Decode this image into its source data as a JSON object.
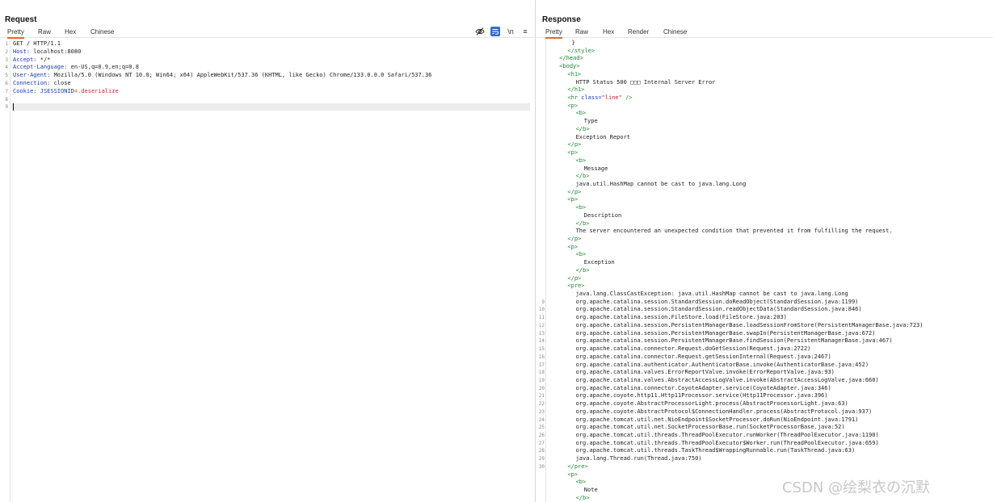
{
  "request": {
    "title": "Request",
    "tabs": [
      "Pretty",
      "Raw",
      "Hex",
      "Chinese"
    ],
    "active_tab": "Pretty",
    "tools": [
      "eye-off-icon",
      "wrap-icon",
      "\\n",
      "≡"
    ],
    "lines": [
      {
        "n": "1",
        "text": "GET / HTTP/1.1"
      },
      {
        "n": "2",
        "name": "Host",
        "value": " localhost:8080"
      },
      {
        "n": "3",
        "name": "Accept",
        "value": " */*"
      },
      {
        "n": "4",
        "name": "Accept-Language",
        "value": " en-US,q=0.9,en;q=0.8"
      },
      {
        "n": "5",
        "name": "User-Agent",
        "value": " Mozilla/5.0 (Windows NT 10.0; Win64; x64) AppleWebKit/537.36 (KHTML, like Gecko) Chrome/133.0.0.0 Safari/537.36"
      },
      {
        "n": "6",
        "name": "Connection",
        "value": " close"
      },
      {
        "n": "7",
        "name": "Cookie",
        "cookie_name": " JSESSIONID",
        "cookie_value": "=.deserialize"
      },
      {
        "n": "8",
        "text": ""
      },
      {
        "n": "9",
        "text": ""
      }
    ]
  },
  "response": {
    "title": "Response",
    "tabs": [
      "Pretty",
      "Raw",
      "Hex",
      "Render",
      "Chinese"
    ],
    "active_tab": "Pretty",
    "lines": [
      {
        "n": "",
        "indent": 10,
        "html": "}"
      },
      {
        "n": "",
        "indent": 8,
        "html": "<span class='tag'>&lt;/style&gt;</span>"
      },
      {
        "n": "",
        "indent": 4,
        "html": "<span class='tag'>&lt;/head&gt;</span>"
      },
      {
        "n": "",
        "indent": 4,
        "html": "<span class='tag'>&lt;body&gt;</span>"
      },
      {
        "n": "",
        "indent": 8,
        "html": "<span class='tag'>&lt;h1&gt;</span>"
      },
      {
        "n": "",
        "indent": 12,
        "html": "HTTP Status 500 □□□ Internal Server Error"
      },
      {
        "n": "",
        "indent": 8,
        "html": "<span class='tag'>&lt;/h1&gt;</span>"
      },
      {
        "n": "",
        "indent": 8,
        "html": "<span class='tag'>&lt;hr </span><span class='attr-name'>class=</span><span class='attr-val'>\"line\"</span><span class='tag'> /&gt;</span>"
      },
      {
        "n": "",
        "indent": 8,
        "html": "<span class='tag'>&lt;p&gt;</span>"
      },
      {
        "n": "",
        "indent": 12,
        "html": "<span class='tag'>&lt;b&gt;</span>"
      },
      {
        "n": "",
        "indent": 16,
        "html": "Type"
      },
      {
        "n": "",
        "indent": 12,
        "html": "<span class='tag'>&lt;/b&gt;</span>"
      },
      {
        "n": "",
        "indent": 12,
        "html": "Exception Report"
      },
      {
        "n": "",
        "indent": 8,
        "html": "<span class='tag'>&lt;/p&gt;</span>"
      },
      {
        "n": "",
        "indent": 8,
        "html": "<span class='tag'>&lt;p&gt;</span>"
      },
      {
        "n": "",
        "indent": 12,
        "html": "<span class='tag'>&lt;b&gt;</span>"
      },
      {
        "n": "",
        "indent": 16,
        "html": "Message"
      },
      {
        "n": "",
        "indent": 12,
        "html": "<span class='tag'>&lt;/b&gt;</span>"
      },
      {
        "n": "",
        "indent": 12,
        "html": "java.util.HashMap cannot be cast to java.lang.Long"
      },
      {
        "n": "",
        "indent": 8,
        "html": "<span class='tag'>&lt;/p&gt;</span>"
      },
      {
        "n": "",
        "indent": 8,
        "html": "<span class='tag'>&lt;p&gt;</span>"
      },
      {
        "n": "",
        "indent": 12,
        "html": "<span class='tag'>&lt;b&gt;</span>"
      },
      {
        "n": "",
        "indent": 16,
        "html": "Description"
      },
      {
        "n": "",
        "indent": 12,
        "html": "<span class='tag'>&lt;/b&gt;</span>"
      },
      {
        "n": "",
        "indent": 12,
        "html": "The server encountered an unexpected condition that prevented it from fulfilling the request."
      },
      {
        "n": "",
        "indent": 8,
        "html": "<span class='tag'>&lt;/p&gt;</span>"
      },
      {
        "n": "",
        "indent": 8,
        "html": "<span class='tag'>&lt;p&gt;</span>"
      },
      {
        "n": "",
        "indent": 12,
        "html": "<span class='tag'>&lt;b&gt;</span>"
      },
      {
        "n": "",
        "indent": 16,
        "html": "Exception"
      },
      {
        "n": "",
        "indent": 12,
        "html": "<span class='tag'>&lt;/b&gt;</span>"
      },
      {
        "n": "",
        "indent": 8,
        "html": "<span class='tag'>&lt;/p&gt;</span>"
      },
      {
        "n": "",
        "indent": 8,
        "html": "<span class='tag'>&lt;pre&gt;</span>"
      },
      {
        "n": "",
        "indent": 12,
        "html": "java.lang.ClassCastException: java.util.HashMap cannot be cast to java.lang.Long"
      },
      {
        "n": "9",
        "indent": 12,
        "html": "org.apache.catalina.session.StandardSession.doReadObject(StandardSession.java:1199)"
      },
      {
        "n": "10",
        "indent": 12,
        "html": "org.apache.catalina.session.StandardSession.readObjectData(StandardSession.java:846)"
      },
      {
        "n": "11",
        "indent": 12,
        "html": "org.apache.catalina.session.FileStore.load(FileStore.java:203)"
      },
      {
        "n": "12",
        "indent": 12,
        "html": "org.apache.catalina.session.PersistentManagerBase.loadSessionFromStore(PersistentManagerBase.java:723)"
      },
      {
        "n": "13",
        "indent": 12,
        "html": "org.apache.catalina.session.PersistentManagerBase.swapIn(PersistentManagerBase.java:672)"
      },
      {
        "n": "14",
        "indent": 12,
        "html": "org.apache.catalina.session.PersistentManagerBase.findSession(PersistentManagerBase.java:467)"
      },
      {
        "n": "15",
        "indent": 12,
        "html": "org.apache.catalina.connector.Request.doGetSession(Request.java:2722)"
      },
      {
        "n": "16",
        "indent": 12,
        "html": "org.apache.catalina.connector.Request.getSessionInternal(Request.java:2467)"
      },
      {
        "n": "17",
        "indent": 12,
        "html": "org.apache.catalina.authenticator.AuthenticatorBase.invoke(AuthenticatorBase.java:452)"
      },
      {
        "n": "18",
        "indent": 12,
        "html": "org.apache.catalina.valves.ErrorReportValve.invoke(ErrorReportValve.java:93)"
      },
      {
        "n": "19",
        "indent": 12,
        "html": "org.apache.catalina.valves.AbstractAccessLogValve.invoke(AbstractAccessLogValve.java:660)"
      },
      {
        "n": "20",
        "indent": 12,
        "html": "org.apache.catalina.connector.CoyoteAdapter.service(CoyoteAdapter.java:346)"
      },
      {
        "n": "21",
        "indent": 12,
        "html": "org.apache.coyote.http11.Http11Processor.service(Http11Processor.java:396)"
      },
      {
        "n": "22",
        "indent": 12,
        "html": "org.apache.coyote.AbstractProcessorLight.process(AbstractProcessorLight.java:63)"
      },
      {
        "n": "23",
        "indent": 12,
        "html": "org.apache.coyote.AbstractProtocol$ConnectionHandler.process(AbstractProtocol.java:937)"
      },
      {
        "n": "24",
        "indent": 12,
        "html": "org.apache.tomcat.util.net.NioEndpoint$SocketProcessor.doRun(NioEndpoint.java:1791)"
      },
      {
        "n": "25",
        "indent": 12,
        "html": "org.apache.tomcat.util.net.SocketProcessorBase.run(SocketProcessorBase.java:52)"
      },
      {
        "n": "26",
        "indent": 12,
        "html": "org.apache.tomcat.util.threads.ThreadPoolExecutor.runWorker(ThreadPoolExecutor.java:1190)"
      },
      {
        "n": "27",
        "indent": 12,
        "html": "org.apache.tomcat.util.threads.ThreadPoolExecutor$Worker.run(ThreadPoolExecutor.java:659)"
      },
      {
        "n": "28",
        "indent": 12,
        "html": "org.apache.tomcat.util.threads.TaskThread$WrappingRunnable.run(TaskThread.java:63)"
      },
      {
        "n": "29",
        "indent": 12,
        "html": "java.lang.Thread.run(Thread.java:750)"
      },
      {
        "n": "30",
        "indent": 8,
        "html": "<span class='tag'>&lt;/pre&gt;</span>"
      },
      {
        "n": "",
        "indent": 8,
        "html": "<span class='tag'>&lt;p&gt;</span>"
      },
      {
        "n": "",
        "indent": 12,
        "html": "<span class='tag'>&lt;b&gt;</span>"
      },
      {
        "n": "",
        "indent": 16,
        "html": "Note"
      },
      {
        "n": "",
        "indent": 12,
        "html": "<span class='tag'>&lt;/b&gt;</span>"
      }
    ]
  },
  "watermark": "CSDN @绘梨衣の沉默"
}
